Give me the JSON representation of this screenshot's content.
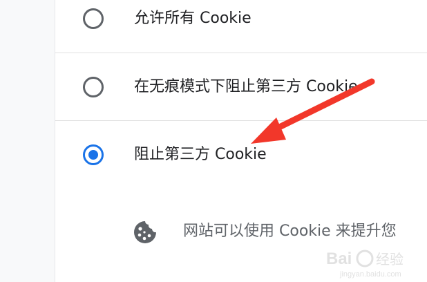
{
  "cookie_options": [
    {
      "label": "允许所有 Cookie",
      "selected": false
    },
    {
      "label": "在无痕模式下阻止第三方 Cookie",
      "selected": false
    },
    {
      "label": "阻止第三方 Cookie",
      "selected": true
    }
  ],
  "info": {
    "text": "网站可以使用 Cookie 来提升您",
    "icon": "cookie-icon"
  },
  "colors": {
    "accent": "#1a73e8",
    "radio_unchecked": "#5f6368",
    "arrow": "#f2372a"
  },
  "watermark": {
    "brand": "Bai经验",
    "url": "jingyan.baidu.com"
  }
}
